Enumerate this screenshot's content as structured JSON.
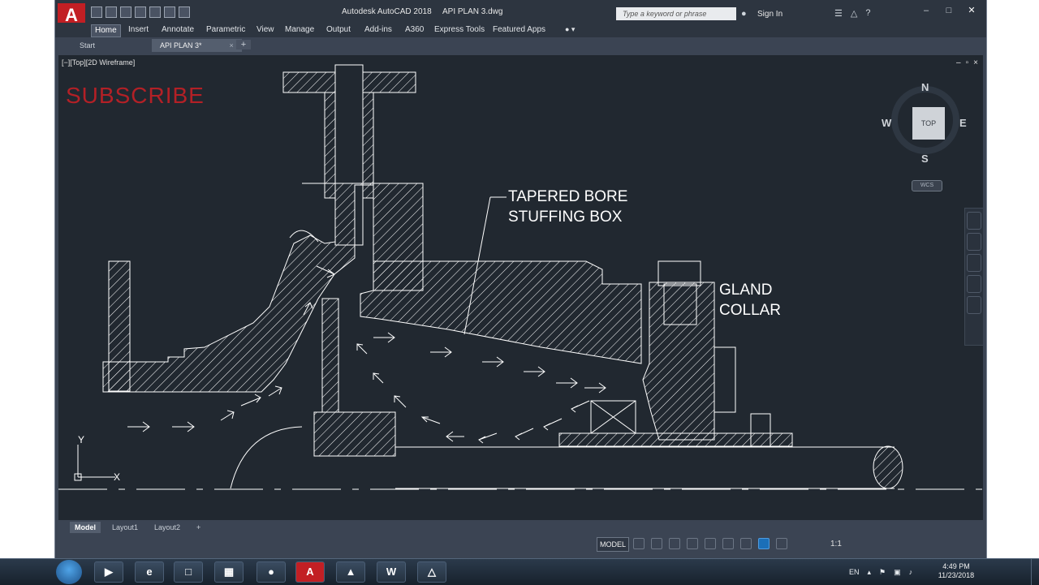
{
  "window": {
    "app_title": "Autodesk AutoCAD 2018",
    "file_title": "API PLAN 3.dwg",
    "logo_letter": "A",
    "search_placeholder": "Type a keyword or phrase",
    "sign_in": "Sign In"
  },
  "ribbon": {
    "tabs": [
      "Home",
      "Insert",
      "Annotate",
      "Parametric",
      "View",
      "Manage",
      "Output",
      "Add-ins",
      "A360",
      "Express Tools",
      "Featured Apps"
    ],
    "active_tab": "Home"
  },
  "file_tabs": [
    {
      "label": "Start"
    },
    {
      "label": "API PLAN 3*",
      "close": "×"
    }
  ],
  "viewport": {
    "label": "[−][Top][2D Wireframe]",
    "controls": [
      "–",
      "▫",
      "×"
    ]
  },
  "drawing": {
    "subscribe_text": "SUBSCRIBE",
    "callout_1_line1": "TAPERED BORE",
    "callout_1_line2": "STUFFING BOX",
    "callout_2_line1": "GLAND",
    "callout_2_line2": "COLLAR",
    "ucs_x": "X",
    "ucs_y": "Y"
  },
  "viewcube": {
    "face": "TOP",
    "north": "N",
    "south": "S",
    "east": "E",
    "west": "W",
    "wcs": "WCS"
  },
  "layout_tabs": [
    "Model",
    "Layout1",
    "Layout2",
    "+"
  ],
  "status": {
    "model_label": "MODEL",
    "scale": "1:1"
  },
  "taskbar": {
    "language": "EN",
    "time": "4:49 PM",
    "date": "11/23/2018"
  },
  "colors": {
    "canvas_bg": "#212830",
    "drawing_lines": "#ffffff",
    "subscribe_red": "#b32026",
    "logo_red": "#c21f24"
  }
}
